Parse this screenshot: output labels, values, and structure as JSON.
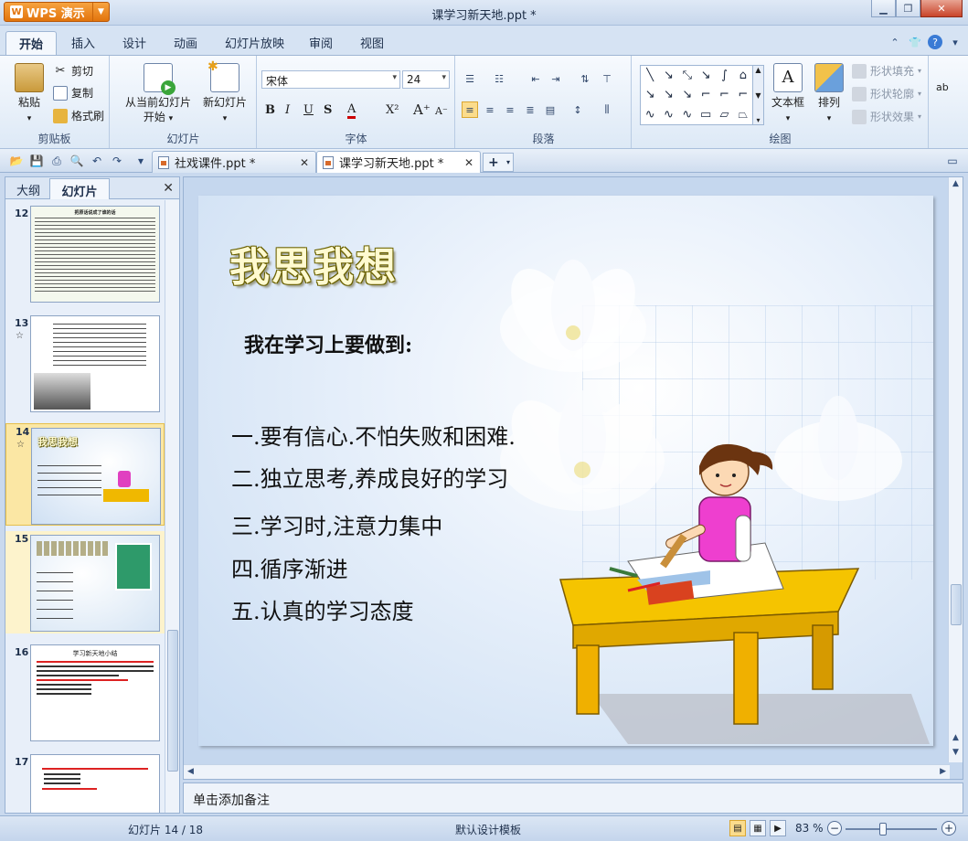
{
  "app": {
    "menu_label": "WPS 演示",
    "window_title": "课学习新天地.ppt *"
  },
  "ribbon_tabs": [
    "开始",
    "插入",
    "设计",
    "动画",
    "幻灯片放映",
    "审阅",
    "视图"
  ],
  "clipboard": {
    "paste": "粘贴",
    "cut": "剪切",
    "copy": "复制",
    "format_painter": "格式刷",
    "label": "剪贴板"
  },
  "slides_group": {
    "from_current": "从当前幻灯片",
    "start": "开始",
    "new_slide": "新幻灯片",
    "label": "幻灯片"
  },
  "font_group": {
    "font_name": "宋体",
    "font_size": "24",
    "label": "字体"
  },
  "paragraph_group": {
    "label": "段落"
  },
  "drawing_group": {
    "textbox": "文本框",
    "arrange": "排列",
    "shape_fill": "形状填充",
    "shape_outline": "形状轮廓",
    "shape_effect": "形状效果",
    "label": "绘图"
  },
  "doc_tabs": [
    {
      "name": "社戏课件.ppt *"
    },
    {
      "name": "课学习新天地.ppt *"
    }
  ],
  "left_panel": {
    "tab_outline": "大纲",
    "tab_slides": "幻灯片"
  },
  "thumbnails": [
    {
      "num": "12",
      "title": "把原话说成了谁的话",
      "star": ""
    },
    {
      "num": "13",
      "title": "",
      "star": "☆"
    },
    {
      "num": "14",
      "title": "我思我想",
      "star": "☆"
    },
    {
      "num": "15",
      "title": "",
      "star": ""
    },
    {
      "num": "16",
      "title": "学习新天地小结",
      "star": ""
    },
    {
      "num": "17",
      "title": "",
      "star": ""
    }
  ],
  "slide": {
    "title": "我思我想",
    "subtitle": "我在学习上要做到:",
    "items": [
      "一.要有信心.不怕失败和困难.",
      "二.独立思考,养成良好的学习",
      "三.学习时,注意力集中",
      "四.循序渐进",
      "五.认真的学习态度"
    ]
  },
  "notes": {
    "placeholder": "单击添加备注"
  },
  "status": {
    "slide_counter": "幻灯片 14 / 18",
    "template": "默认设计模板",
    "zoom": "83 %",
    "zoom_percent": 83
  }
}
